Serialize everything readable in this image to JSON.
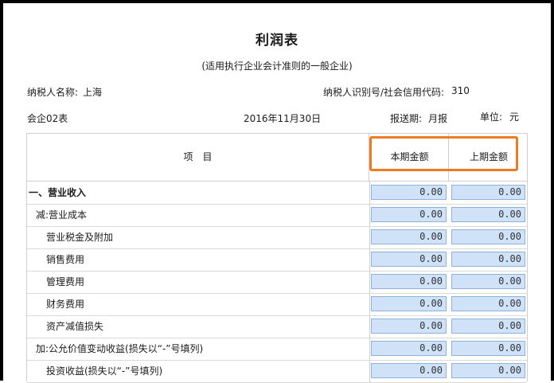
{
  "report": {
    "title": "利润表",
    "subtitle": "(适用执行企业会计准则的一般企业)",
    "taxpayer_name_label": "纳税人名称:",
    "taxpayer_name_value": "上海",
    "taxpayer_id_label": "纳税人识别号/社会信用代码:",
    "taxpayer_id_value": "310",
    "form_code": "会企02表",
    "date": "2016年11月30日",
    "period_label": "报送期:",
    "period_value": "月报",
    "unit_label": "单位:",
    "unit_value": "元"
  },
  "table": {
    "header": {
      "item": "项　目",
      "current": "本期金额",
      "previous": "上期金额"
    },
    "rows": [
      {
        "label": "一、营业收入",
        "current": "0.00",
        "previous": "0.00"
      },
      {
        "label": "减:营业成本",
        "current": "0.00",
        "previous": "0.00"
      },
      {
        "label": "营业税金及附加",
        "current": "0.00",
        "previous": "0.00"
      },
      {
        "label": "销售费用",
        "current": "0.00",
        "previous": "0.00"
      },
      {
        "label": "管理费用",
        "current": "0.00",
        "previous": "0.00"
      },
      {
        "label": "财务费用",
        "current": "0.00",
        "previous": "0.00"
      },
      {
        "label": "资产减值损失",
        "current": "0.00",
        "previous": "0.00"
      },
      {
        "label": "加:公允价值变动收益(损失以“-”号填列)",
        "current": "0.00",
        "previous": "0.00"
      },
      {
        "label": "投资收益(损失以“-”号填列)",
        "current": "0.00",
        "previous": "0.00"
      }
    ]
  },
  "colors": {
    "highlight": "#f07a22",
    "input_bg": "#cfe2f8",
    "input_border": "#8fb2da"
  }
}
